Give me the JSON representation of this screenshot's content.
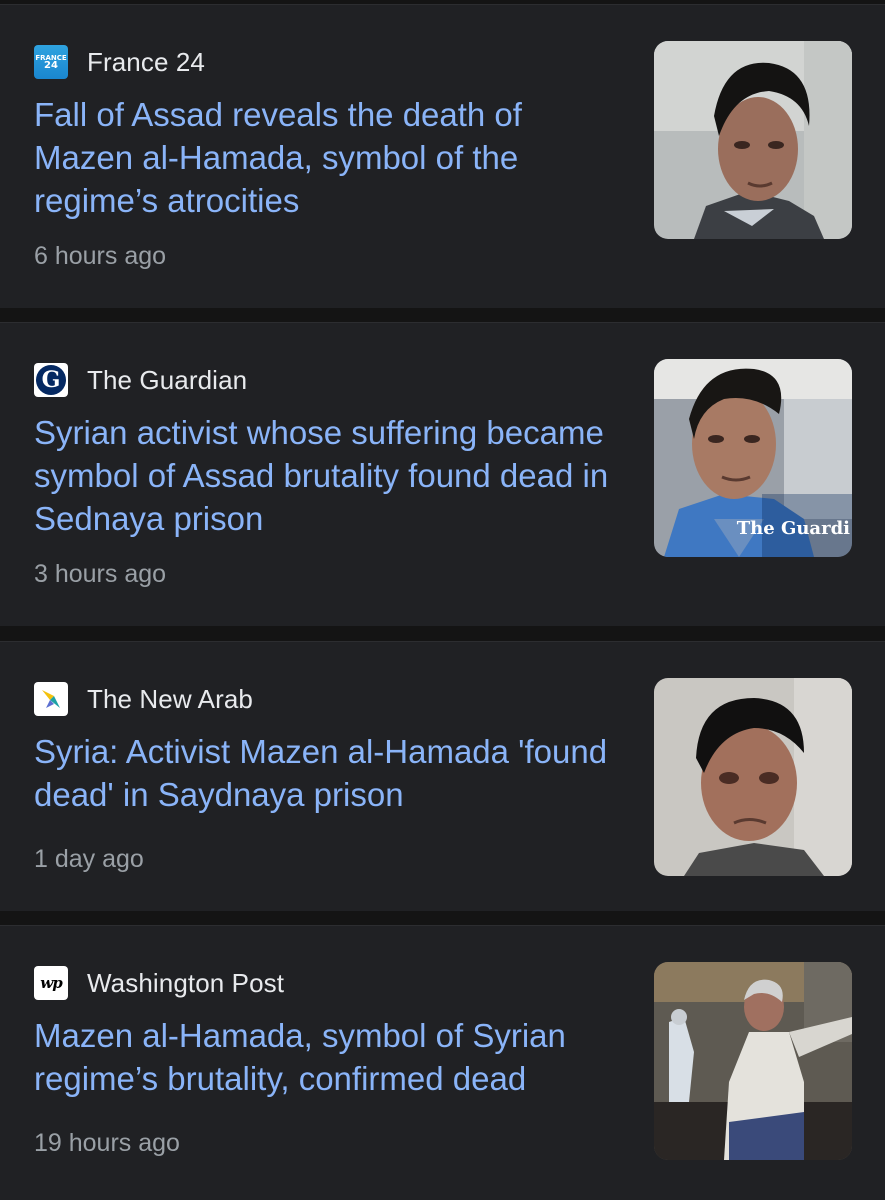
{
  "articles": [
    {
      "source": "France 24",
      "source_icon": "france24-logo-icon",
      "headline": "Fall of Assad reveals the death of Mazen al-Hamada, symbol of the regime’s atrocities",
      "time": "6 hours ago"
    },
    {
      "source": "The Guardian",
      "source_icon": "guardian-logo-icon",
      "headline": "Syrian activist whose suffering became symbol of Assad brutality found dead in Sednaya prison",
      "time": "3 hours ago",
      "thumb_watermark": "The Guardi"
    },
    {
      "source": "The New Arab",
      "source_icon": "new-arab-logo-icon",
      "headline": "Syria: Activist Mazen al-Hamada 'found dead' in Saydnaya prison",
      "time": "1 day ago"
    },
    {
      "source": "Washington Post",
      "source_icon": "washington-post-logo-icon",
      "headline": "Mazen al-Hamada, symbol of Syrian regime’s brutality, confirmed dead",
      "time": "19 hours ago"
    }
  ],
  "colors": {
    "background": "#141414",
    "card": "#202124",
    "headline": "#8ab4f8",
    "source_text": "#e8eaed",
    "time_text": "#9aa0a6"
  }
}
